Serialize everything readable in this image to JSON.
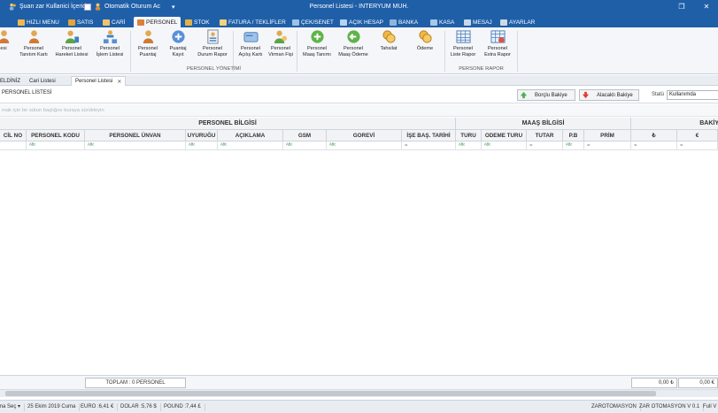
{
  "titlebar": {
    "user_status": "Şuan zar Kullanici İçeride",
    "auto_login": "Otomatik Oturum Ac",
    "dropdown_glyph": "▾",
    "window_title": "Personel Listesi - INTERYUM MUH.",
    "restore_glyph": "❐",
    "close_glyph": "✕"
  },
  "ribbon_tabs": [
    {
      "label": "HIZLI MENU",
      "icon_color": "#f2b84b"
    },
    {
      "label": "SATIS",
      "icon_color": "#e8a23c"
    },
    {
      "label": "CARİ",
      "icon_color": "#f0c36b"
    },
    {
      "label": "PERSONEL",
      "icon_color": "#d9803b",
      "active": true
    },
    {
      "label": "STOK",
      "icon_color": "#e2b04a"
    },
    {
      "label": "FATURA / TEKLİFLER",
      "icon_color": "#f3d27a"
    },
    {
      "label": "ÇEK/SENET",
      "icon_color": "#9cc3e6"
    },
    {
      "label": "AÇIK HESAP",
      "icon_color": "#b8d3ef"
    },
    {
      "label": "BANKA",
      "icon_color": "#8fb4de"
    },
    {
      "label": "KASA",
      "icon_color": "#a9c7e8"
    },
    {
      "label": "MESAJ",
      "icon_color": "#c8d8ea"
    },
    {
      "label": "AYARLAR",
      "icon_color": "#cfd9e4"
    }
  ],
  "ribbon": {
    "buttons": [
      {
        "line1": "",
        "line2": "esi",
        "icon": "person-icon"
      },
      {
        "line1": "Personel",
        "line2": "Tanıtım Kartı",
        "icon": "person-icon"
      },
      {
        "line1": "Personel",
        "line2": "Hareket Listesi",
        "icon": "person-list-icon"
      },
      {
        "line1": "Personel",
        "line2": "İşlem Listesi",
        "icon": "org-chart-icon"
      },
      {
        "line1": "Personel",
        "line2": "Puantaj",
        "icon": "person-icon"
      },
      {
        "line1": "Puantaj",
        "line2": "Kayıt",
        "icon": "plus-circle-icon"
      },
      {
        "line1": "Personel",
        "line2": "Durum Rapor",
        "icon": "report-icon"
      },
      {
        "line1": "Personel",
        "line2": "Açılış Kartı",
        "icon": "card-icon"
      },
      {
        "line1": "Personel",
        "line2": "Virman Fişi",
        "icon": "transfer-icon"
      },
      {
        "line1": "Personel",
        "line2": "Maaş Tanımı",
        "icon": "plus-green-icon"
      },
      {
        "line1": "Personel",
        "line2": "Maaş Ödeme",
        "icon": "arrow-green-icon"
      },
      {
        "line1": "Tahsilat",
        "line2": "",
        "icon": "coins-icon"
      },
      {
        "line1": "Ödeme",
        "line2": "",
        "icon": "coins-icon"
      },
      {
        "line1": "Personel",
        "line2": "Liste Rapor",
        "icon": "table-icon"
      },
      {
        "line1": "Personel",
        "line2": "Extra Rapor",
        "icon": "table-extra-icon"
      }
    ],
    "group_personel": "PERSONEL YÖNETİMİ",
    "group_rapor": "PERSONE RAPOR"
  },
  "doc_tabs": [
    {
      "label": "ELDİNİZ"
    },
    {
      "label": "Cari Listesi"
    },
    {
      "label": "Personel Listesi",
      "active": true,
      "close": "✕"
    }
  ],
  "panel": {
    "title": "PERSONEL LİSTESİ",
    "borclu_button": "Borçlu Bakiye",
    "alacakli_button": "Alacaklı Bakiye",
    "statu_label": "Statü",
    "statu_value": "Kullanımda",
    "group_hint": "mak için bir sütun başlığını buraya sürükleyin"
  },
  "grid": {
    "band_personel": "PERSONEL BİLGİSİ",
    "band_maas": "MAAŞ BİLGİSİ",
    "band_bakiye": "BAKİY",
    "columns": [
      "CİL NO",
      "PERSONEL KODU",
      "PERSONEL ÜNVAN",
      "UYURUĞU",
      "AÇIKLAMA",
      "GSM",
      "GOREVİ",
      "İŞE BAŞ. TARİHİ",
      "TURU",
      "ODEME TURU",
      "TUTAR",
      "P.B",
      "PRİM",
      "₺",
      "€"
    ],
    "filters": [
      "",
      "ᴬᴮᶜ",
      "ᴬᴮᶜ",
      "ᴬᴮᶜ",
      "ᴬᴮᶜ",
      "ᴬᴮᶜ",
      "ᴬᴮᶜ",
      "=",
      "ᴬᴮᶜ",
      "ᴬᴮᶜ",
      "=",
      "ᴬᴮᶜ",
      "=",
      "=",
      "="
    ]
  },
  "footer": {
    "total_label": "TOPLAM : 0 PERSONEL",
    "tl_total": "0,00 ₺",
    "eur_total": "0,00 €"
  },
  "statusbar": {
    "sema": "ma Seç ▾",
    "date": "25 Ekim 2019 Cuma",
    "euro": "EURO :6,41 €",
    "dolar": "DOLAR :5,76 $",
    "pound": "POUND :7,44 £",
    "company": "ZAROTOMASYON",
    "version": "ZAR OTOMASYON V 0.1",
    "full": "Full V"
  },
  "colors": {
    "titlebar": "#1f5fa8",
    "ribbon_bg": "#f4f6f9",
    "filter_green": "#2e8b3a"
  }
}
